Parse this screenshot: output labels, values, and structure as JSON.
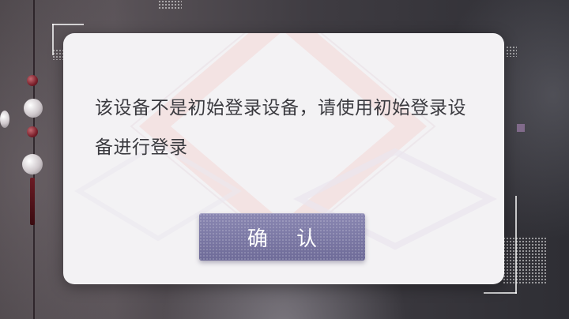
{
  "dialog": {
    "message": "该设备不是初始登录设备，请使用初始登录设备进行登录",
    "confirm_label": "确 认"
  },
  "colors": {
    "dialog_background": "#f3f2f4",
    "message_text": "#3a3a3f",
    "button_background": "#7b78a2",
    "button_text": "#ffffff"
  }
}
